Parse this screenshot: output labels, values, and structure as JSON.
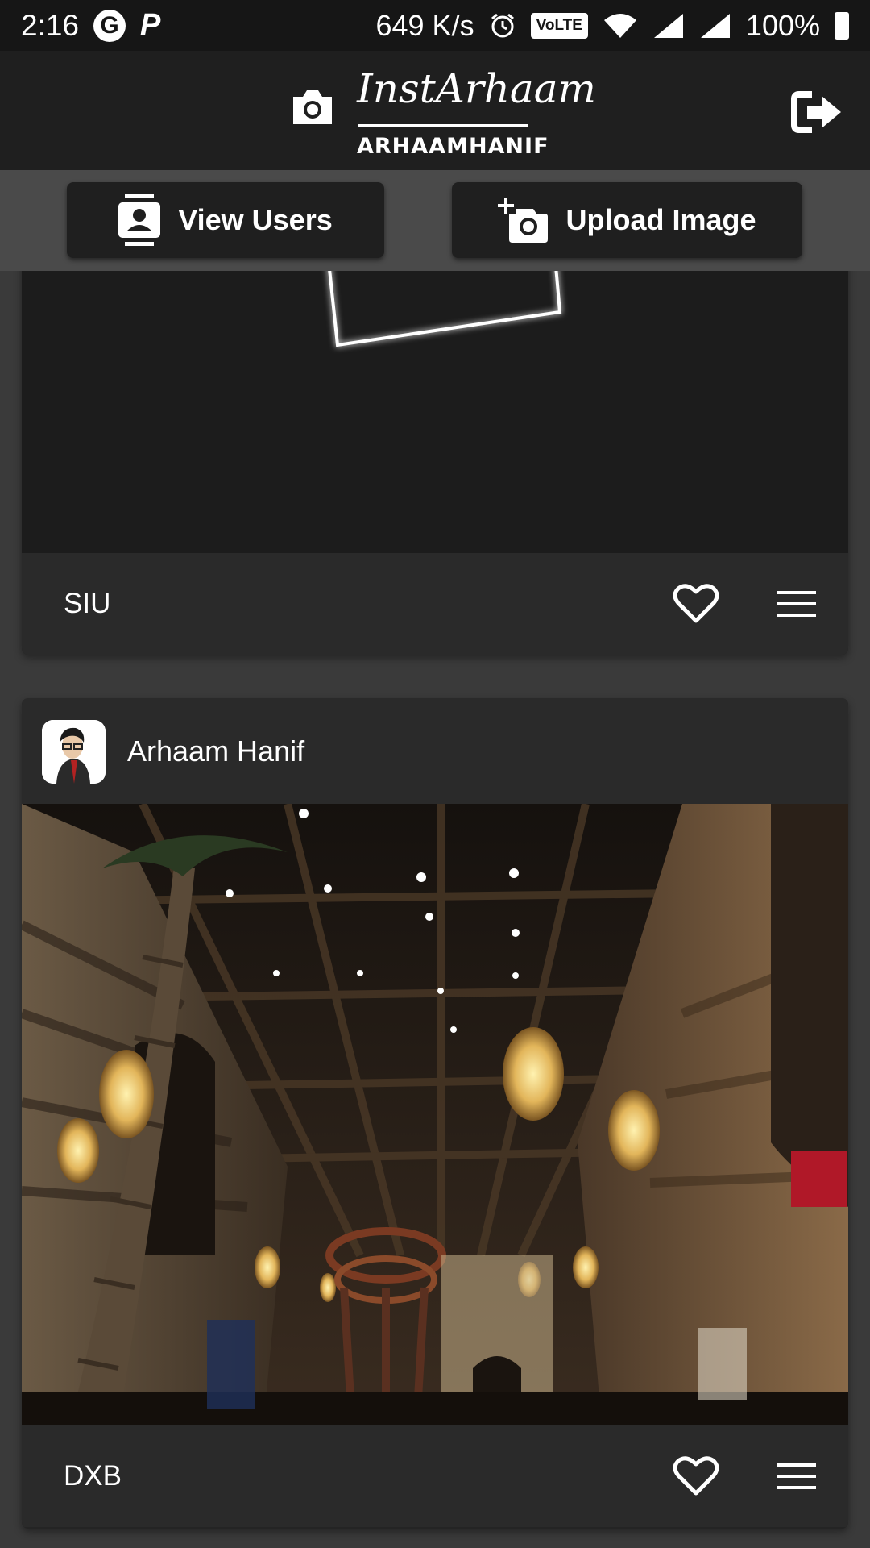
{
  "status_bar": {
    "time": "2:16",
    "net_speed": "649 K/s",
    "volte": "VoLTE",
    "battery": "100%",
    "icons": [
      "google-icon",
      "p-icon",
      "alarm-icon",
      "volte-icon",
      "wifi-icon",
      "signal-icon",
      "signal-icon",
      "battery-icon"
    ]
  },
  "app_bar": {
    "title": "InstArhaam",
    "subtitle": "ARHAAMHANIF",
    "icons": [
      "camera-icon",
      "logout-icon"
    ]
  },
  "actions": {
    "view_users": "View Users",
    "upload_image": "Upload Image"
  },
  "posts": [
    {
      "caption": "SIU"
    },
    {
      "author": "Arhaam Hanif",
      "caption": "DXB"
    }
  ],
  "colors": {
    "status_bg": "#161616",
    "appbar_bg": "#1f1f1f",
    "page_bg": "#3a3a3a",
    "card_bg": "#2a2a2a"
  }
}
